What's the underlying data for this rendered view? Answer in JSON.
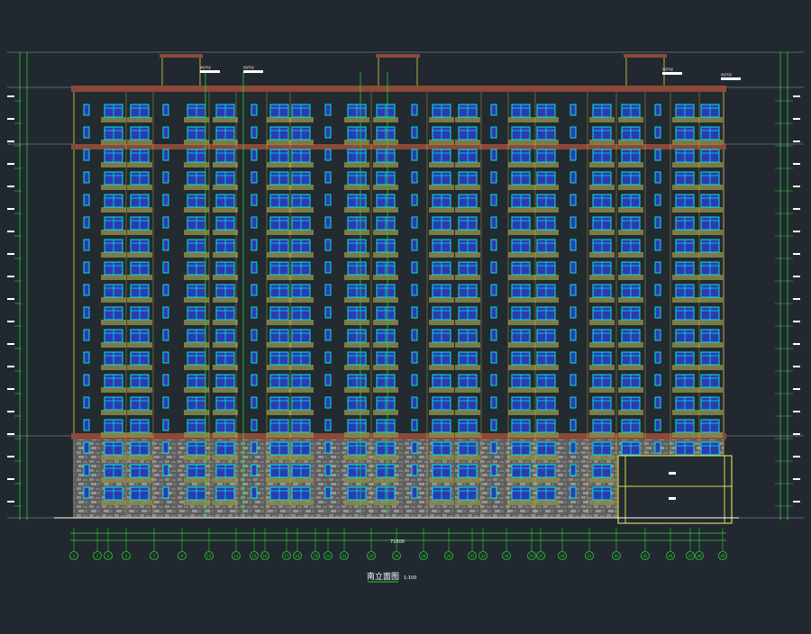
{
  "drawing": {
    "title": "南立面图",
    "scale": "1:100",
    "overall_dimension": "71600"
  },
  "axis_labels": [
    "1",
    "2",
    "3",
    "5",
    "7",
    "9",
    "11",
    "13",
    "15",
    "16",
    "17",
    "18",
    "19",
    "20",
    "22",
    "24",
    "26",
    "28",
    "29",
    "31",
    "32",
    "34",
    "35",
    "37",
    "39",
    "41",
    "43",
    "45",
    "46",
    "47",
    "48",
    "49"
  ],
  "floor_count": 18,
  "callouts": [
    "详见节点",
    "详见节点",
    "详见节点",
    "详见节点"
  ],
  "colors": {
    "background": "#212830",
    "wall_line": "#d8d84a",
    "window_frame": "#00e5e5",
    "window_glass": "#2d3bb0",
    "balcony": "#8a8a4a",
    "cornice": "#8a4a3a",
    "stone_base": "#6d6d6d",
    "dim_line": "#2ad02a",
    "text": "#ffffff"
  }
}
